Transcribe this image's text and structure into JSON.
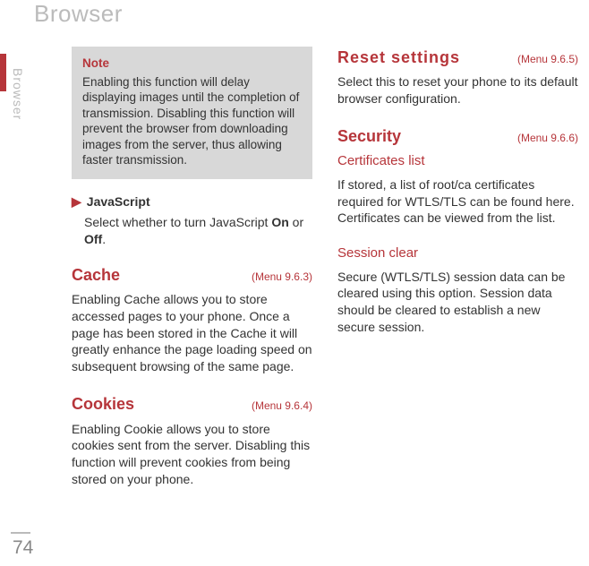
{
  "header": {
    "title": "Browser"
  },
  "side": {
    "label": "Browser"
  },
  "left": {
    "note": {
      "title": "Note",
      "body": "Enabling this function will delay displaying images until the completion of transmission. Disabling this function will prevent the browser from downloading images from the server, thus allowing faster transmission."
    },
    "js": {
      "head": "JavaScript",
      "body_pre": "Select whether to turn JavaScript ",
      "on": "On",
      "mid": " or ",
      "off": "Off",
      "end": "."
    },
    "cache": {
      "title": "Cache",
      "menu": "(Menu 9.6.3)",
      "body": "Enabling Cache allows you to store accessed pages to your phone. Once a page has been stored in the Cache it will greatly enhance the page loading speed on subsequent browsing of the same page."
    },
    "cookies": {
      "title": "Cookies",
      "menu": "(Menu 9.6.4)",
      "body": "Enabling Cookie allows you to store cookies sent from the server. Disabling this function will prevent cookies from being stored on your phone."
    }
  },
  "right": {
    "reset": {
      "title": "Reset settings",
      "menu": "(Menu 9.6.5)",
      "body": "Select this to reset your phone to its default browser configuration."
    },
    "security": {
      "title": "Security",
      "menu": "(Menu 9.6.6)"
    },
    "certs": {
      "title": "Certificates list",
      "body": "If stored, a list of root/ca certificates required for WTLS/TLS can be found here. Certificates can be viewed from the list."
    },
    "session": {
      "title": "Session clear",
      "body": "Secure (WTLS/TLS) session data can be cleared using this option. Session data should be cleared to establish a new secure session."
    }
  },
  "page": {
    "number": "74"
  }
}
